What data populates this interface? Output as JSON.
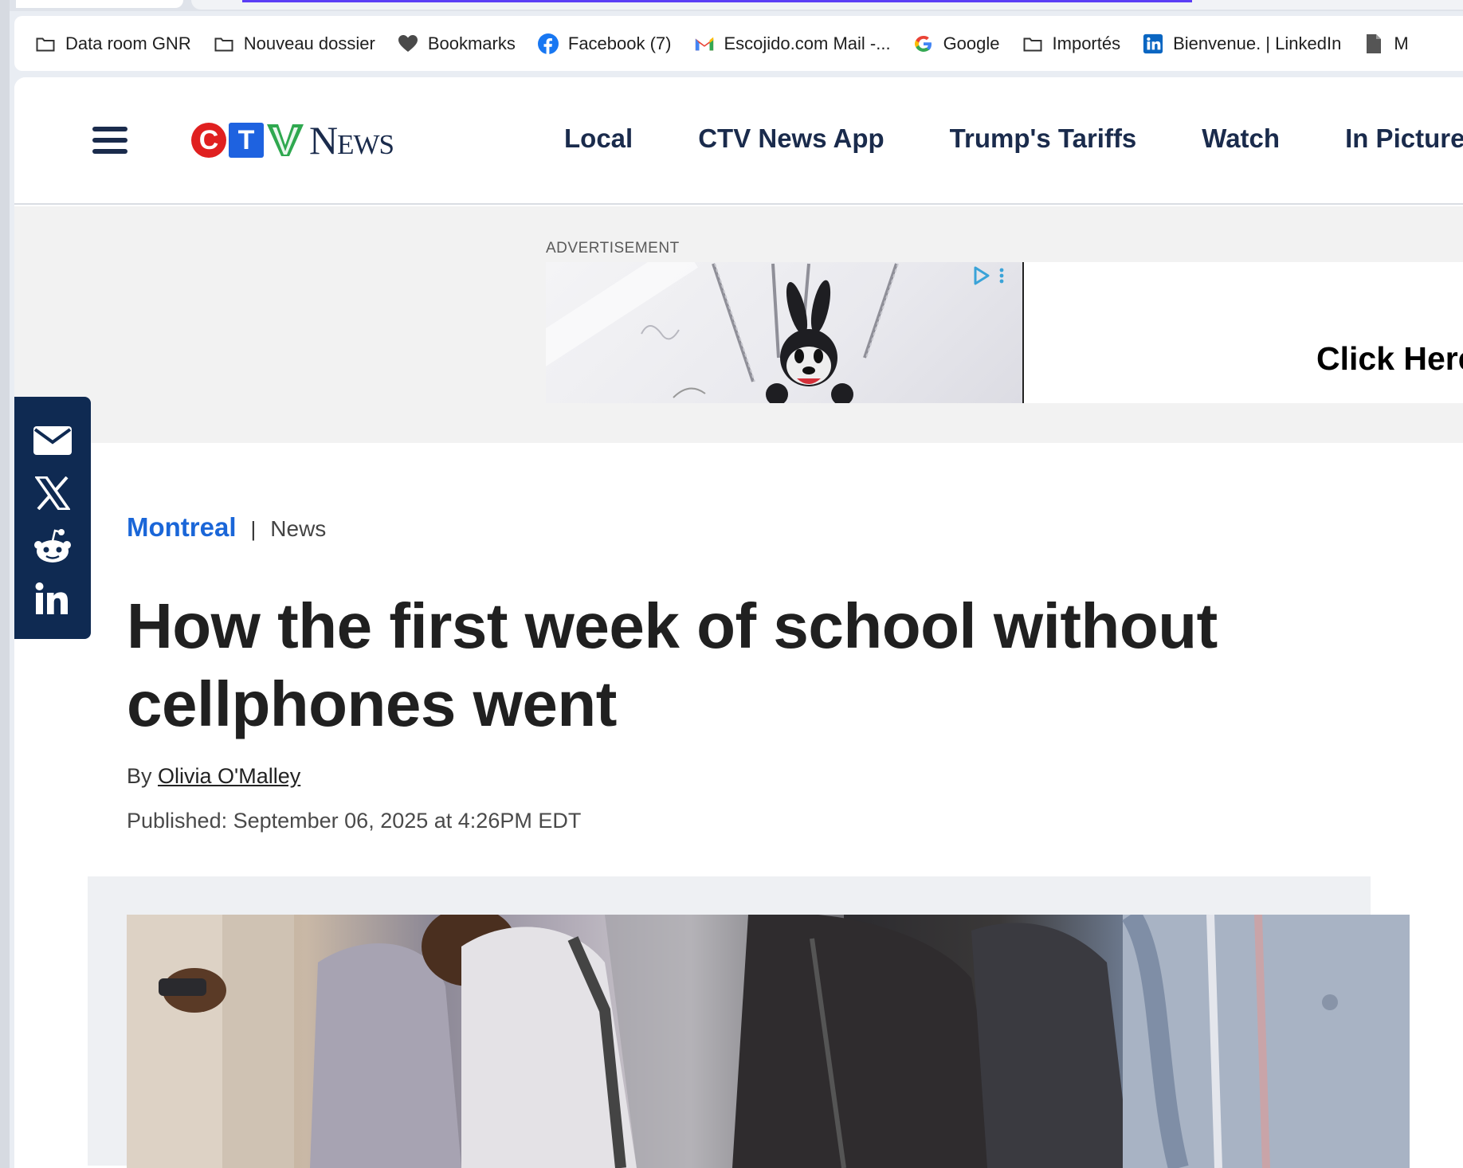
{
  "bookmarks": [
    {
      "label": "Data room GNR",
      "icon": "folder-icon"
    },
    {
      "label": "Nouveau dossier",
      "icon": "folder-icon"
    },
    {
      "label": "Bookmarks",
      "icon": "heart-icon"
    },
    {
      "label": "Facebook (7)",
      "icon": "facebook-icon"
    },
    {
      "label": "Escojido.com Mail -...",
      "icon": "gmail-icon"
    },
    {
      "label": "Google",
      "icon": "google-icon"
    },
    {
      "label": "Importés",
      "icon": "folder-icon"
    },
    {
      "label": "Bienvenue. | LinkedIn",
      "icon": "linkedin-icon"
    },
    {
      "label": "M",
      "icon": "document-icon"
    }
  ],
  "site": {
    "logo_letters": [
      "C",
      "T",
      "V"
    ],
    "logo_news": "News",
    "nav": [
      "Local",
      "CTV News App",
      "Trump's Tariffs",
      "Watch",
      "In Pictures"
    ]
  },
  "ad": {
    "label": "ADVERTISEMENT",
    "cta": "Click Here"
  },
  "share": {
    "icons": [
      "email-icon",
      "x-icon",
      "reddit-icon",
      "linkedin-icon"
    ]
  },
  "article": {
    "city": "Montreal",
    "separator": "|",
    "section": "News",
    "headline": "How the first week of school without cellphones went",
    "by": "By",
    "author": "Olivia O'Malley",
    "published": "Published: September 06, 2025 at 4:26PM EDT"
  },
  "colors": {
    "brand_navy": "#1a2b4c",
    "link_blue": "#1a66d8",
    "ctv_red": "#e02020",
    "ctv_blue": "#1e62e0",
    "ctv_green": "#2fa84f",
    "share_bg": "#0f2a52",
    "progress": "#5b3df5"
  }
}
